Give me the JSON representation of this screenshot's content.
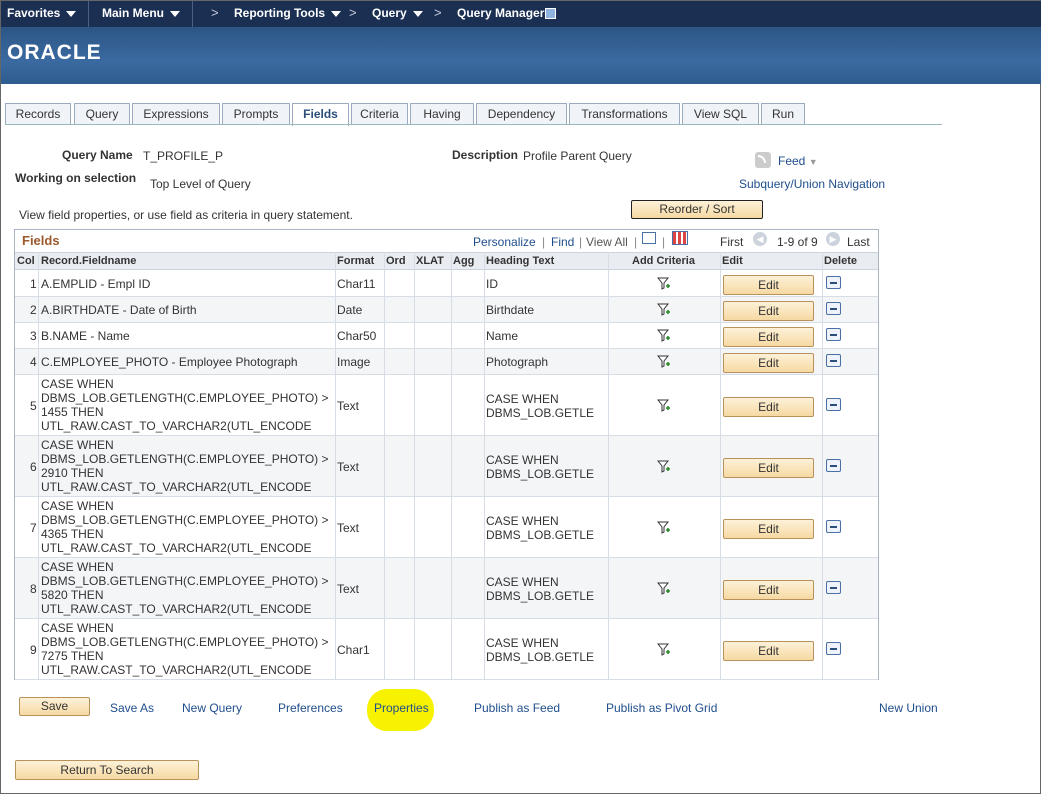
{
  "nav": {
    "favorites": "Favorites",
    "main_menu": "Main Menu",
    "crumbs": [
      "Reporting Tools",
      "Query",
      "Query Manager"
    ]
  },
  "banner": {
    "logo": "ORACLE"
  },
  "tabs": [
    "Records",
    "Query",
    "Expressions",
    "Prompts",
    "Fields",
    "Criteria",
    "Having",
    "Dependency",
    "Transformations",
    "View SQL",
    "Run"
  ],
  "active_tab": "Fields",
  "header": {
    "query_name_label": "Query Name",
    "query_name": "T_PROFILE_P",
    "description_label": "Description",
    "description": "Profile Parent Query",
    "working_label": "Working on selection",
    "working_value": "Top Level of Query",
    "feed_label": "Feed",
    "subquery_link": "Subquery/Union Navigation",
    "instructions": "View field properties, or use field as criteria in query statement.",
    "reorder_button": "Reorder / Sort"
  },
  "grid": {
    "title": "Fields",
    "personalize": "Personalize",
    "find": "Find",
    "view_all": "View All",
    "first": "First",
    "range": "1-9 of 9",
    "last": "Last",
    "columns": [
      "Col",
      "Record.Fieldname",
      "Format",
      "Ord",
      "XLAT",
      "Agg",
      "Heading Text",
      "Add Criteria",
      "Edit",
      "Delete"
    ],
    "edit_label": "Edit",
    "rows": [
      {
        "col": "1",
        "field": "A.EMPLID - Empl ID",
        "format": "Char11",
        "heading": "ID"
      },
      {
        "col": "2",
        "field": "A.BIRTHDATE - Date of Birth",
        "format": "Date",
        "heading": "Birthdate"
      },
      {
        "col": "3",
        "field": "B.NAME - Name",
        "format": "Char50",
        "heading": "Name"
      },
      {
        "col": "4",
        "field": "C.EMPLOYEE_PHOTO - Employee Photograph",
        "format": "Image",
        "heading": "Photograph"
      },
      {
        "col": "5",
        "field": "CASE WHEN\nDBMS_LOB.GETLENGTH(C.EMPLOYEE_PHOTO) >\n1455 THEN\nUTL_RAW.CAST_TO_VARCHAR2(UTL_ENCODE",
        "format": "Text",
        "heading": "CASE WHEN\nDBMS_LOB.GETLE"
      },
      {
        "col": "6",
        "field": "CASE WHEN\nDBMS_LOB.GETLENGTH(C.EMPLOYEE_PHOTO) >\n2910 THEN\nUTL_RAW.CAST_TO_VARCHAR2(UTL_ENCODE",
        "format": "Text",
        "heading": "CASE WHEN\nDBMS_LOB.GETLE"
      },
      {
        "col": "7",
        "field": "CASE WHEN\nDBMS_LOB.GETLENGTH(C.EMPLOYEE_PHOTO) >\n4365 THEN\nUTL_RAW.CAST_TO_VARCHAR2(UTL_ENCODE",
        "format": "Text",
        "heading": "CASE WHEN\nDBMS_LOB.GETLE"
      },
      {
        "col": "8",
        "field": "CASE WHEN\nDBMS_LOB.GETLENGTH(C.EMPLOYEE_PHOTO) >\n5820 THEN\nUTL_RAW.CAST_TO_VARCHAR2(UTL_ENCODE",
        "format": "Text",
        "heading": "CASE WHEN\nDBMS_LOB.GETLE"
      },
      {
        "col": "9",
        "field": "CASE WHEN\nDBMS_LOB.GETLENGTH(C.EMPLOYEE_PHOTO) >\n7275 THEN\nUTL_RAW.CAST_TO_VARCHAR2(UTL_ENCODE",
        "format": "Char1",
        "heading": "CASE WHEN\nDBMS_LOB.GETLE"
      }
    ]
  },
  "footer": {
    "save": "Save",
    "save_as": "Save As",
    "new_query": "New Query",
    "preferences": "Preferences",
    "properties": "Properties",
    "publish_feed": "Publish as Feed",
    "publish_pivot": "Publish as Pivot Grid",
    "new_union": "New Union",
    "return": "Return To Search"
  },
  "colors": {
    "nav_bg": "#1a2f52",
    "banner": "#2f5c8e",
    "grid_title": "#9b5a2c",
    "link": "#1f4e8c",
    "highlight": "#f7f200"
  }
}
